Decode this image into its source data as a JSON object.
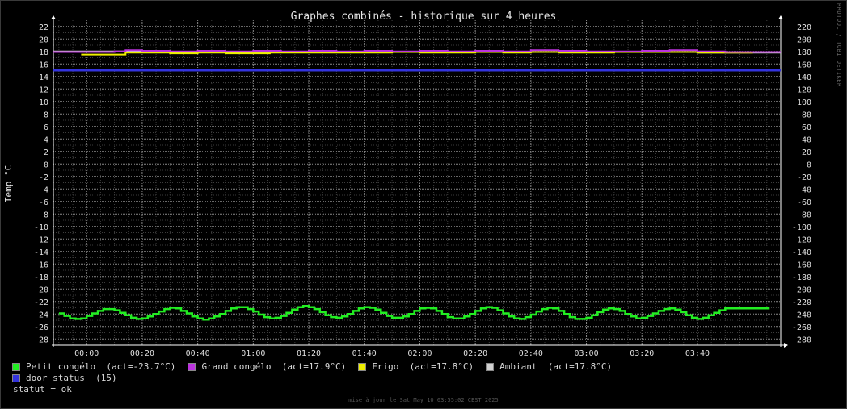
{
  "chart_data": {
    "type": "line",
    "title": "Graphes combinés - historique sur 4 heures",
    "ylabel": "Temp °C",
    "ylim": [
      -29,
      23
    ],
    "y2lim": [
      -290,
      230
    ],
    "yticks": [
      22,
      20,
      18,
      16,
      14,
      12,
      10,
      8,
      6,
      4,
      2,
      0,
      -2,
      -4,
      -6,
      -8,
      -10,
      -12,
      -14,
      -16,
      -18,
      -20,
      -22,
      -24,
      -26,
      -28
    ],
    "y2ticks": [
      220,
      200,
      180,
      160,
      140,
      120,
      100,
      80,
      60,
      40,
      20,
      0,
      -20,
      -40,
      -60,
      -80,
      -100,
      -120,
      -140,
      -160,
      -180,
      -200,
      -220,
      -240,
      -260,
      -280
    ],
    "xlim": [
      -12,
      250
    ],
    "xticks": [
      {
        "t": 0,
        "label": "00:00"
      },
      {
        "t": 20,
        "label": "00:20"
      },
      {
        "t": 40,
        "label": "00:40"
      },
      {
        "t": 60,
        "label": "01:00"
      },
      {
        "t": 80,
        "label": "01:20"
      },
      {
        "t": 100,
        "label": "01:40"
      },
      {
        "t": 120,
        "label": "02:00"
      },
      {
        "t": 140,
        "label": "02:20"
      },
      {
        "t": 160,
        "label": "02:40"
      },
      {
        "t": 180,
        "label": "03:00"
      },
      {
        "t": 200,
        "label": "03:20"
      },
      {
        "t": 220,
        "label": "03:40"
      }
    ],
    "grid": true,
    "series": [
      {
        "name": "Petit congélo",
        "color": "#22ee22",
        "x": [
          -10,
          -8,
          -6,
          -4,
          -2,
          0,
          2,
          4,
          6,
          8,
          10,
          12,
          14,
          16,
          18,
          20,
          22,
          24,
          26,
          28,
          30,
          32,
          34,
          36,
          38,
          40,
          42,
          44,
          46,
          48,
          50,
          52,
          54,
          56,
          58,
          60,
          62,
          64,
          66,
          68,
          70,
          72,
          74,
          76,
          78,
          80,
          82,
          84,
          86,
          88,
          90,
          92,
          94,
          96,
          98,
          100,
          102,
          104,
          106,
          108,
          110,
          112,
          114,
          116,
          118,
          120,
          122,
          124,
          126,
          128,
          130,
          132,
          134,
          136,
          138,
          140,
          142,
          144,
          146,
          148,
          150,
          152,
          154,
          156,
          158,
          160,
          162,
          164,
          166,
          168,
          170,
          172,
          174,
          176,
          178,
          180,
          182,
          184,
          186,
          188,
          190,
          192,
          194,
          196,
          198,
          200,
          202,
          204,
          206,
          208,
          210,
          212,
          214,
          216,
          218,
          220,
          222,
          224,
          226,
          228,
          230,
          232,
          234,
          236,
          238,
          240,
          242,
          244,
          246
        ],
        "values": [
          -23.9,
          -24.3,
          -24.7,
          -24.8,
          -24.7,
          -24.3,
          -23.9,
          -23.5,
          -23.2,
          -23.2,
          -23.4,
          -23.8,
          -24.2,
          -24.6,
          -24.8,
          -24.7,
          -24.4,
          -24.0,
          -23.6,
          -23.2,
          -23.0,
          -23.1,
          -23.5,
          -23.9,
          -24.4,
          -24.7,
          -24.9,
          -24.7,
          -24.4,
          -24.0,
          -23.5,
          -23.1,
          -22.9,
          -22.9,
          -23.2,
          -23.6,
          -24.1,
          -24.5,
          -24.7,
          -24.6,
          -24.3,
          -23.8,
          -23.3,
          -22.9,
          -22.7,
          -22.9,
          -23.2,
          -23.7,
          -24.2,
          -24.5,
          -24.6,
          -24.4,
          -24.0,
          -23.5,
          -23.1,
          -22.9,
          -23.0,
          -23.3,
          -23.8,
          -24.3,
          -24.6,
          -24.6,
          -24.4,
          -24.0,
          -23.5,
          -23.1,
          -23.0,
          -23.1,
          -23.5,
          -24.0,
          -24.5,
          -24.7,
          -24.7,
          -24.4,
          -24.0,
          -23.5,
          -23.1,
          -22.9,
          -23.0,
          -23.4,
          -23.9,
          -24.4,
          -24.7,
          -24.8,
          -24.5,
          -24.1,
          -23.6,
          -23.2,
          -23.0,
          -23.1,
          -23.5,
          -24.0,
          -24.5,
          -24.8,
          -24.8,
          -24.6,
          -24.2,
          -23.7,
          -23.3,
          -23.1,
          -23.2,
          -23.5,
          -24.0,
          -24.4,
          -24.7,
          -24.6,
          -24.3,
          -23.9,
          -23.5,
          -23.2,
          -23.1,
          -23.3,
          -23.7,
          -24.2,
          -24.6,
          -24.8,
          -24.6,
          -24.2,
          -23.8,
          -23.4,
          -23.1,
          -23.1,
          -23.1,
          -23.1,
          -23.1,
          -23.1,
          -23.1,
          -23.1,
          -23.1
        ],
        "legend_label": "Petit congélo  (act=-23.7°C)"
      },
      {
        "name": "Grand congélo",
        "color": "#bb33dd",
        "x": [
          -12,
          0,
          10,
          14,
          20,
          30,
          40,
          50,
          60,
          70,
          80,
          90,
          100,
          110,
          120,
          130,
          140,
          150,
          160,
          170,
          180,
          190,
          200,
          210,
          220,
          230,
          240,
          250
        ],
        "values": [
          17.9,
          17.9,
          18.0,
          18.2,
          18.1,
          18.0,
          18.1,
          18.0,
          18.1,
          18.0,
          18.1,
          18.0,
          18.1,
          18.0,
          18.1,
          18.0,
          18.1,
          18.0,
          18.2,
          18.1,
          18.0,
          18.0,
          18.1,
          18.2,
          18.0,
          17.9,
          17.9,
          17.9
        ],
        "legend_label": "Grand congélo  (act=17.9°C)"
      },
      {
        "name": "Frigo",
        "color": "#eeee00",
        "x": [
          -2,
          0,
          12,
          14,
          30,
          40,
          50,
          60,
          66,
          70,
          80,
          90,
          100,
          110,
          120,
          130,
          140,
          150,
          160,
          170,
          180,
          190,
          200,
          210,
          220,
          230,
          240
        ],
        "values": [
          17.5,
          17.5,
          17.5,
          17.8,
          17.7,
          17.8,
          17.7,
          17.7,
          17.8,
          17.8,
          17.8,
          17.8,
          17.8,
          17.9,
          17.8,
          17.8,
          17.9,
          17.8,
          17.9,
          17.8,
          17.8,
          17.9,
          17.9,
          17.9,
          17.8,
          17.8,
          17.8
        ],
        "legend_label": "Frigo  (act=17.8°C)"
      },
      {
        "name": "Ambiant",
        "color": "#d0d0d0",
        "x": [
          -12,
          0,
          20,
          40,
          60,
          80,
          100,
          120,
          140,
          160,
          180,
          200,
          220,
          240,
          250
        ],
        "values": [
          18.0,
          18.0,
          17.9,
          17.9,
          17.9,
          17.9,
          17.9,
          17.9,
          17.9,
          17.9,
          17.9,
          17.9,
          17.8,
          17.8,
          17.8
        ],
        "legend_label": "Ambiant  (act=17.8°C)"
      },
      {
        "name": "door status",
        "color": "#3333dd",
        "axis": "right",
        "x": [
          -12,
          250
        ],
        "values": [
          150,
          150
        ],
        "legend_label": "door status  (15)"
      }
    ]
  },
  "status": "statut = ok",
  "footer": "mise à jour le Sat May 10 03:55:02 CEST 2025",
  "watermark": "RRDTOOL / TOBI OETIKER"
}
